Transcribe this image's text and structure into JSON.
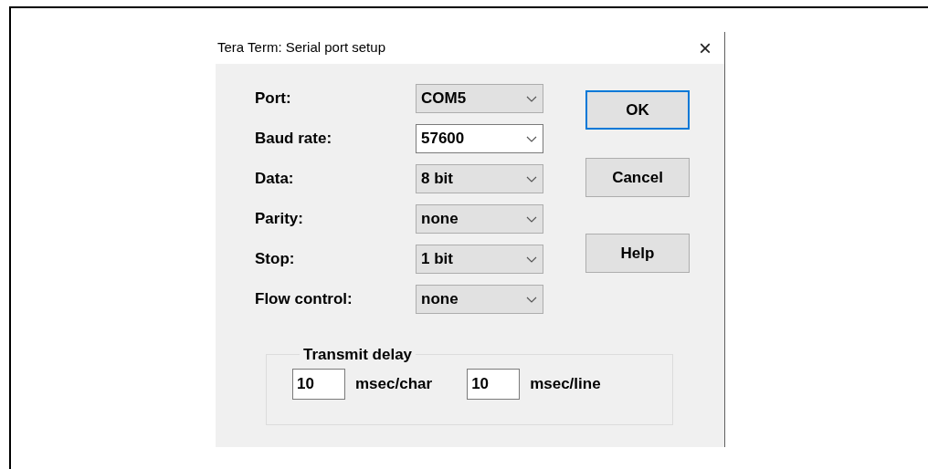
{
  "window": {
    "title": "Tera Term: Serial port setup",
    "close": "×"
  },
  "fields": [
    {
      "label": "Port:",
      "value": "COM5",
      "kind": "dropdown"
    },
    {
      "label": "Baud rate:",
      "value": "57600",
      "kind": "editable"
    },
    {
      "label": "Data:",
      "value": "8 bit",
      "kind": "dropdown"
    },
    {
      "label": "Parity:",
      "value": "none",
      "kind": "dropdown"
    },
    {
      "label": "Stop:",
      "value": "1 bit",
      "kind": "dropdown"
    },
    {
      "label": "Flow control:",
      "value": "none",
      "kind": "dropdown"
    }
  ],
  "buttons": [
    {
      "label": "OK",
      "default": true
    },
    {
      "label": "Cancel",
      "default": false
    },
    {
      "label": "Help",
      "default": false
    }
  ],
  "transmit_delay": {
    "title": "Transmit delay",
    "inputs": [
      {
        "value": "10",
        "unit": "msec/char"
      },
      {
        "value": "10",
        "unit": "msec/line"
      }
    ]
  }
}
